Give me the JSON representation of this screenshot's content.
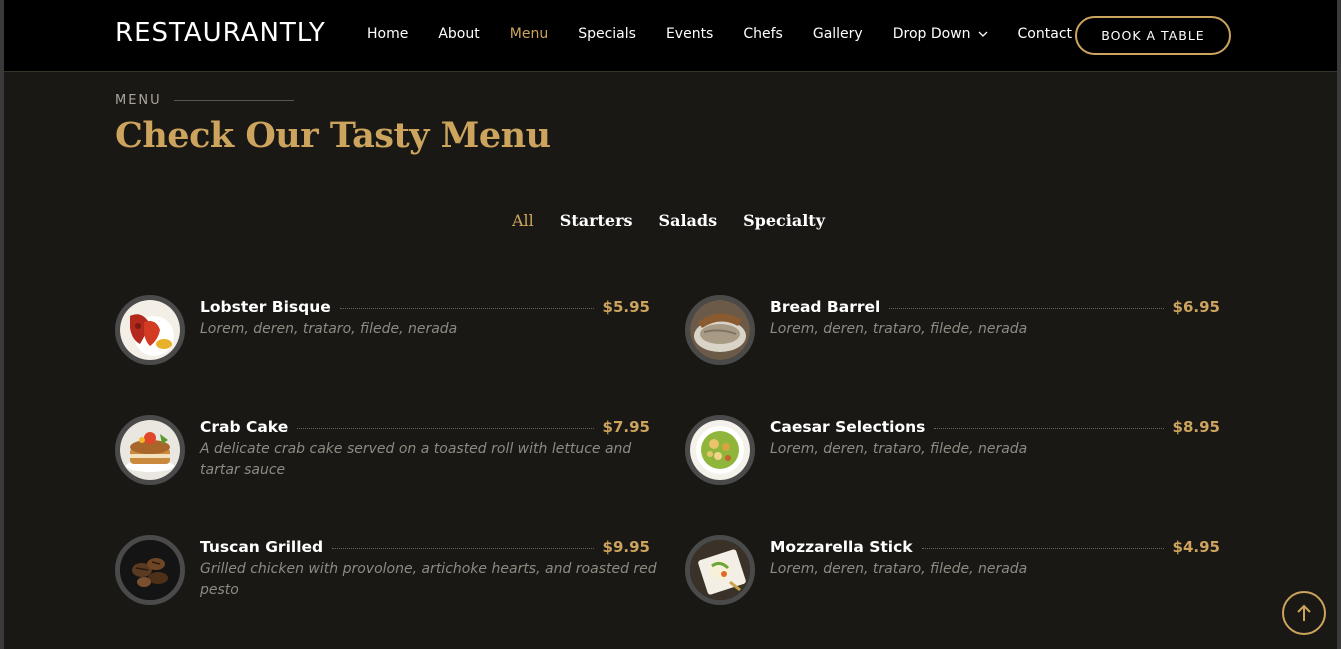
{
  "header": {
    "logo": "RESTAURANTLY",
    "nav": [
      {
        "label": "Home"
      },
      {
        "label": "About"
      },
      {
        "label": "Menu"
      },
      {
        "label": "Specials"
      },
      {
        "label": "Events"
      },
      {
        "label": "Chefs"
      },
      {
        "label": "Gallery"
      },
      {
        "label": "Drop Down"
      },
      {
        "label": "Contact"
      }
    ],
    "active_nav": "Menu",
    "book_button": "BOOK A TABLE"
  },
  "section": {
    "label": "MENU",
    "title": "Check Our Tasty Menu"
  },
  "filters": [
    "All",
    "Starters",
    "Salads",
    "Specialty"
  ],
  "active_filter": "All",
  "menu_items": [
    {
      "name": "Lobster Bisque",
      "price": "$5.95",
      "description": "Lorem, deren, trataro, filede, nerada",
      "icon": "lobster-bisque-photo"
    },
    {
      "name": "Bread Barrel",
      "price": "$6.95",
      "description": "Lorem, deren, trataro, filede, nerada",
      "icon": "bread-barrel-photo"
    },
    {
      "name": "Crab Cake",
      "price": "$7.95",
      "description": "A delicate crab cake served on a toasted roll with lettuce and tartar sauce",
      "icon": "crab-cake-photo"
    },
    {
      "name": "Caesar Selections",
      "price": "$8.95",
      "description": "Lorem, deren, trataro, filede, nerada",
      "icon": "caesar-salad-photo"
    },
    {
      "name": "Tuscan Grilled",
      "price": "$9.95",
      "description": "Grilled chicken with provolone, artichoke hearts, and roasted red pesto",
      "icon": "tuscan-grilled-photo"
    },
    {
      "name": "Mozzarella Stick",
      "price": "$4.95",
      "description": "Lorem, deren, trataro, filede, nerada",
      "icon": "mozzarella-stick-photo"
    }
  ],
  "colors": {
    "accent": "#cda45e",
    "background": "#1a1814",
    "header": "#000000"
  }
}
